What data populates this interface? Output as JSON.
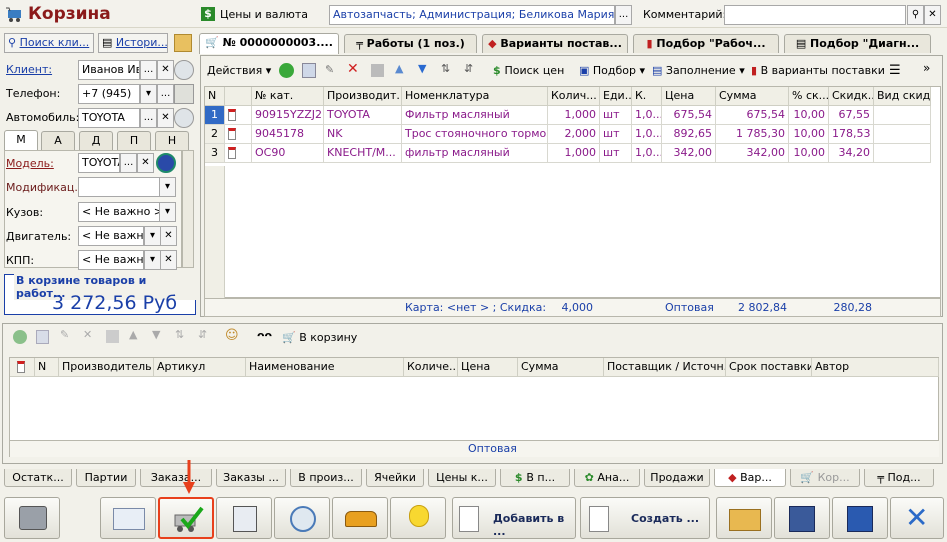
{
  "window": {
    "title": "Корзина"
  },
  "header": {
    "prices_link": "Цены и валюта",
    "agreement_value": "Автозапчасть; Администрация; Беликова Мария Серге",
    "comment_label": "Комментарий:",
    "comment_value": ""
  },
  "left": {
    "search_client": "Поиск кли...",
    "history": "Истори...",
    "client_label": "Клиент:",
    "client_value": "Иванов Ив",
    "phone_label": "Телефон:",
    "phone_value": "+7 (945)",
    "car_label": "Автомобиль:",
    "car_value": "TOYOTA",
    "tabs": [
      "М",
      "А",
      "Д",
      "П",
      "Н"
    ],
    "model_label": "Модель:",
    "model_value": "TOYOTA",
    "modification_label": "Модификац.:",
    "modification_value": "",
    "body_label": "Кузов:",
    "body_value": "< Не важно >",
    "engine_label": "Двигатель:",
    "engine_value": "< Не важно",
    "gearbox_label": "КПП:",
    "gearbox_value": "< Не важно",
    "total_caption": "В корзине товаров и работ...",
    "total_value": "3 272,56 Руб"
  },
  "top_tabs": [
    "№ 0000000003....",
    "Работы (1 поз.)",
    "Варианты постав...",
    "Подбор \"Рабоч...",
    "Подбор \"Диагн..."
  ],
  "grid_toolbar": {
    "actions": "Действия",
    "search_prices": "Поиск цен",
    "selection": "Подбор",
    "fill": "Заполнение",
    "to_variants": "В варианты поставки"
  },
  "grid": {
    "columns": [
      "N",
      "",
      "№ кат.",
      "Производит...",
      "Номенклатура",
      "Колич...",
      "Еди...",
      "К.",
      "Цена",
      "Сумма",
      "% ск...",
      "Скидк...",
      "Вид скид..."
    ],
    "rows": [
      [
        "1",
        "",
        "90915YZZJ2",
        "TOYOTA",
        "Фильтр масляный",
        "1,000",
        "шт",
        "1,0...",
        "675,54",
        "675,54",
        "10,00",
        "67,55",
        ""
      ],
      [
        "2",
        "",
        "9045178",
        "NK",
        "Трос стояночного тормоза",
        "2,000",
        "шт",
        "1,0...",
        "892,65",
        "1 785,30",
        "10,00",
        "178,53",
        ""
      ],
      [
        "3",
        "",
        "OC90",
        "KNECHT/M...",
        "фильтр масляный",
        "1,000",
        "шт",
        "1,0...",
        "342,00",
        "342,00",
        "10,00",
        "34,20",
        ""
      ]
    ],
    "footer": {
      "card": "Карта: <нет > ; Скидка: ...",
      "qty": "4,000",
      "price_type": "Оптовая",
      "sum": "2 802,84",
      "discount": "280,28"
    }
  },
  "bottom_toolbar": {
    "to_cart": "В корзину"
  },
  "bottom_grid": {
    "columns": [
      "",
      "N",
      "Производитель",
      "Артикул",
      "Наименование",
      "Количе...",
      "Цена",
      "Сумма",
      "Поставщик / Источн...",
      "Срок поставки",
      "Автор"
    ],
    "footer_price": "Оптовая"
  },
  "bottom_tabs": [
    "Остатк...",
    "Партии",
    "Заказа...",
    "Заказы ...",
    "В произ...",
    "Ячейки",
    "Цены к...",
    "В п...",
    "Ана...",
    "Продажи",
    "Вар...",
    "Кор...",
    "Под..."
  ],
  "actions": {
    "add_to": "Добавить в ...",
    "create": "Создать ..."
  },
  "colors": {
    "accent_red": "#e8401c",
    "title_red": "#8b1a1a",
    "link_blue": "#1a3fa8",
    "row_text": "#8a1a8a",
    "selected_row": "#316ac5"
  }
}
